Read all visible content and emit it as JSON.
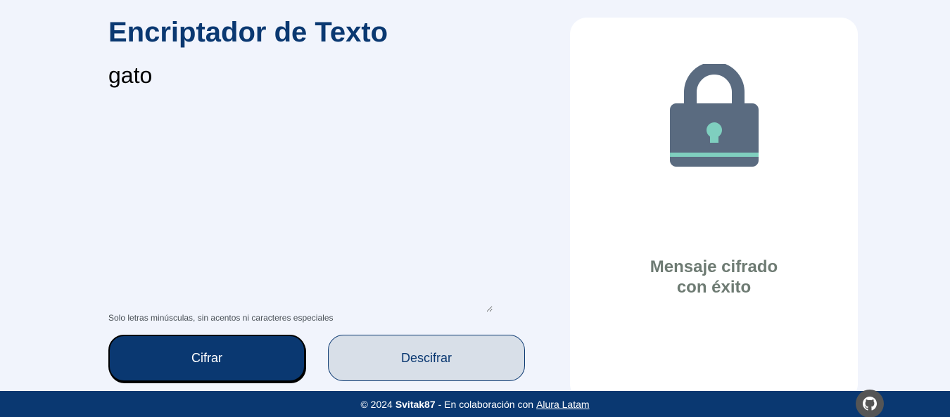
{
  "app": {
    "title": "Encriptador de Texto"
  },
  "input": {
    "value": "gato",
    "hint": "Solo letras minúsculas, sin acentos ni caracteres especiales"
  },
  "buttons": {
    "encrypt_label": "Cifrar",
    "decrypt_label": "Descifrar"
  },
  "result": {
    "line1": "Mensaje cifrado",
    "line2": "con éxito",
    "icon": "lock-icon"
  },
  "footer": {
    "copyright": "© 2024",
    "author": "Svitak87",
    "collab_text": "- En colaboración con",
    "link_text": "Alura Latam",
    "github_icon": "github-icon"
  },
  "colors": {
    "primary": "#0a3871",
    "background": "#f1f4fc",
    "lock_body": "#5a6b80",
    "lock_accent": "#7fcfbf",
    "message": "#6e7b73"
  }
}
